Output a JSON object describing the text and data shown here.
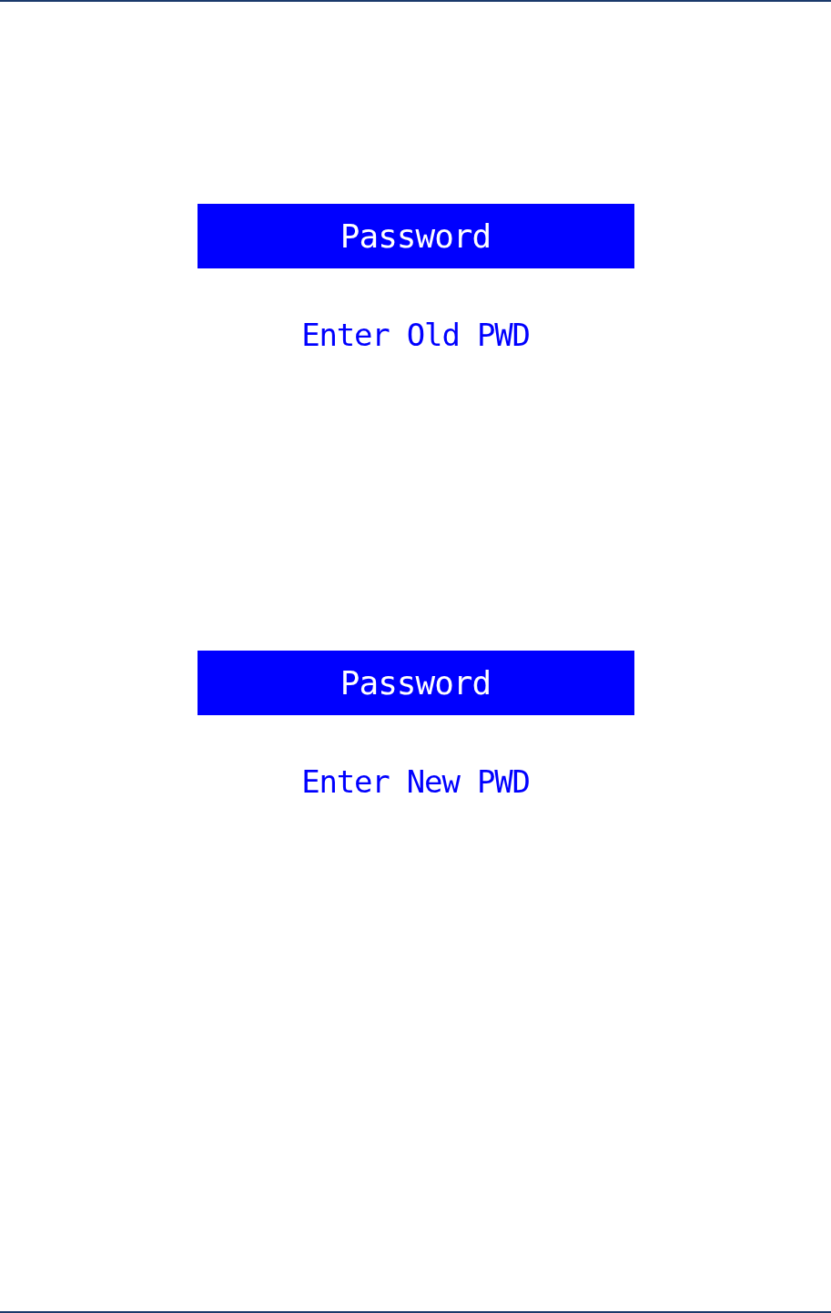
{
  "screens": [
    {
      "title": "Password",
      "prompt": "Enter Old PWD"
    },
    {
      "title": "Password",
      "prompt": "Enter New PWD"
    }
  ]
}
